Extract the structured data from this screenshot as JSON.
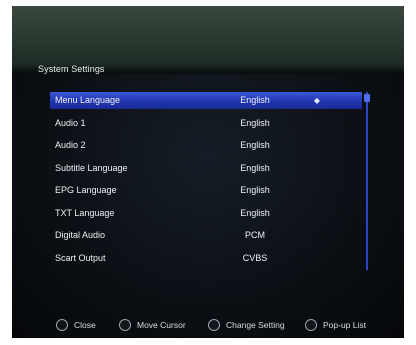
{
  "title": "System Settings",
  "menu": {
    "items": [
      {
        "label": "Menu Language",
        "value": "English"
      },
      {
        "label": "Audio 1",
        "value": "English"
      },
      {
        "label": "Audio 2",
        "value": "English"
      },
      {
        "label": "Subtitle Language",
        "value": "English"
      },
      {
        "label": "EPG Language",
        "value": "English"
      },
      {
        "label": "TXT Language",
        "value": "English"
      },
      {
        "label": "Digital Audio",
        "value": "PCM"
      },
      {
        "label": "Scart Output",
        "value": "CVBS"
      }
    ],
    "selected_index": 0
  },
  "footer": {
    "close": "Close",
    "move_cursor": "Move Cursor",
    "change_setting": "Change Setting",
    "popup_list": "Pop-up List"
  },
  "colors": {
    "highlight": "#2a40c0",
    "header_band": "#2f3f35",
    "background": "#0b0f14",
    "text": "#eef2f5"
  },
  "icons": {
    "selection_arrows": "left-right-arrows-icon",
    "footer_keys": [
      "exit-key-icon",
      "ok-key-icon",
      "arrow-key-icon",
      "ok-key-icon"
    ]
  }
}
